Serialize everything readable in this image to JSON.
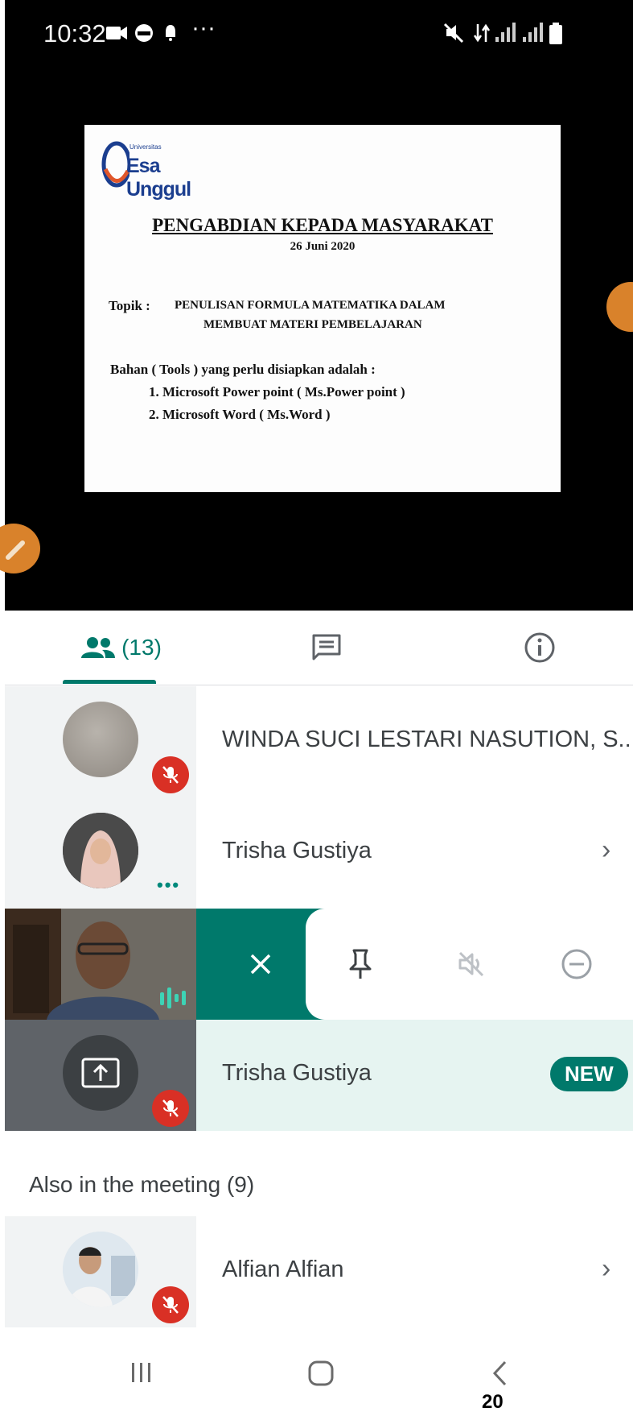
{
  "status_bar": {
    "time": "10:32",
    "overflow": "···"
  },
  "slide": {
    "logo_small": "Universitas",
    "logo_text": "Esa Unggul",
    "title": "PENGABDIAN KEPADA MASYARAKAT",
    "date": "26 Juni 2020",
    "topic_label": "Topik :",
    "topic_line1": "PENULISAN FORMULA MATEMATIKA DALAM",
    "topic_line2": "MEMBUAT MATERI PEMBELAJARAN",
    "tools_heading": "Bahan ( Tools ) yang perlu disiapkan adalah :",
    "tools": [
      "1.  Microsoft Power point ( Ms.Power point )",
      "2.  Microsoft Word ( Ms.Word )"
    ]
  },
  "tabs": {
    "people_count": "(13)"
  },
  "participants": [
    {
      "name": "WINDA SUCI LESTARI NASUTION, S...."
    },
    {
      "name": "Trisha Gustiya"
    },
    {
      "name": "Trisha Gustiya",
      "badge": "NEW"
    }
  ],
  "also_heading": "Also in the meeting (9)",
  "also_participants": [
    {
      "name": "Alfian Alfian"
    }
  ],
  "page_number": "20",
  "colors": {
    "accent": "#00796b",
    "mute_red": "#d93025",
    "highlight_bg": "#e6f4f1"
  }
}
